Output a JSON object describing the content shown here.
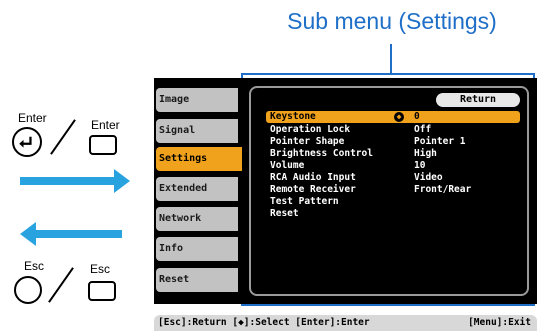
{
  "callout": {
    "title": "Sub menu (Settings)"
  },
  "keys": {
    "enter_label_1": "Enter",
    "enter_label_2": "Enter",
    "esc_label_1": "Esc",
    "esc_label_2": "Esc"
  },
  "colors": {
    "accent": "#f0a21c",
    "callout": "#1f6fc8",
    "arrow": "#29a3e0"
  },
  "menu": {
    "tabs": [
      {
        "label": "Image"
      },
      {
        "label": "Signal"
      },
      {
        "label": "Settings",
        "active": true
      },
      {
        "label": "Extended"
      },
      {
        "label": "Network"
      },
      {
        "label": "Info"
      },
      {
        "label": "Reset"
      }
    ],
    "return_label": "Return",
    "items": [
      {
        "label": "Keystone",
        "value": "0",
        "icon": "adjust-icon",
        "selected": true
      },
      {
        "label": "Operation Lock",
        "value": "Off"
      },
      {
        "label": "Pointer Shape",
        "value": "Pointer 1"
      },
      {
        "label": "Brightness Control",
        "value": "High"
      },
      {
        "label": "Volume",
        "value": "10"
      },
      {
        "label": "RCA Audio Input",
        "value": "Video"
      },
      {
        "label": "Remote Receiver",
        "value": "Front/Rear"
      },
      {
        "label": "Test Pattern",
        "value": ""
      },
      {
        "label": "Reset",
        "value": ""
      }
    ]
  },
  "status": {
    "left": "[Esc]:Return [◆]:Select [Enter]:Enter",
    "right": "[Menu]:Exit"
  }
}
